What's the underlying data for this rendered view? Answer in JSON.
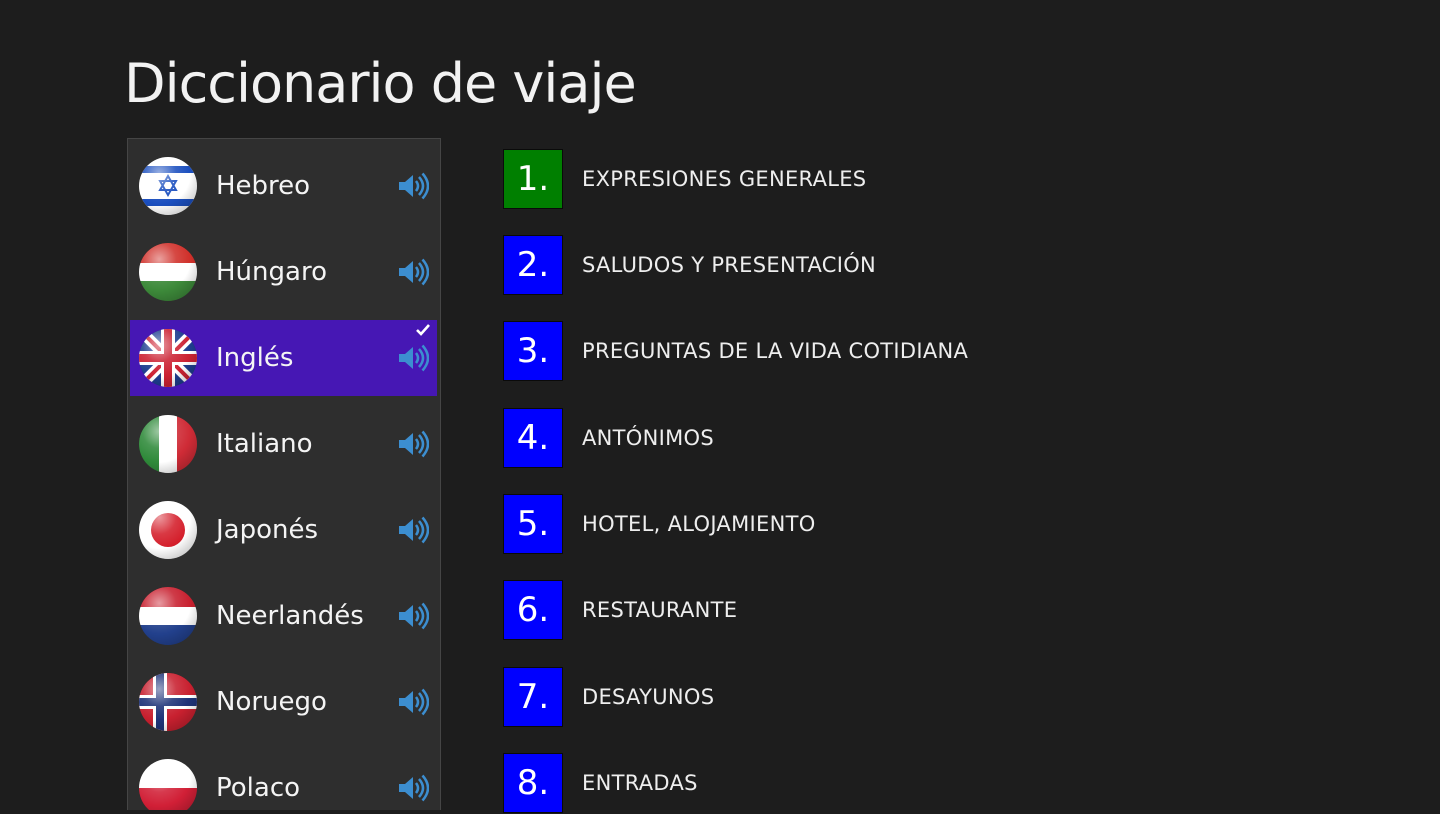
{
  "app": {
    "title": "Diccionario de viaje"
  },
  "colors": {
    "background": "#1d1d1d",
    "panel": "#2e2e2e",
    "selected": "#4617b4",
    "first_category": "#007f00",
    "category": "#0000ff",
    "speaker": "#3c8ed0"
  },
  "languages": [
    {
      "name": "Hebreo",
      "flag_icon": "israel-flag-icon",
      "selected": false
    },
    {
      "name": "Húngaro",
      "flag_icon": "hungary-flag-icon",
      "selected": false
    },
    {
      "name": "Inglés",
      "flag_icon": "uk-flag-icon",
      "selected": true
    },
    {
      "name": "Italiano",
      "flag_icon": "italy-flag-icon",
      "selected": false
    },
    {
      "name": "Japonés",
      "flag_icon": "japan-flag-icon",
      "selected": false
    },
    {
      "name": "Neerlandés",
      "flag_icon": "netherlands-flag-icon",
      "selected": false
    },
    {
      "name": "Noruego",
      "flag_icon": "norway-flag-icon",
      "selected": false
    },
    {
      "name": "Polaco",
      "flag_icon": "poland-flag-icon",
      "selected": false
    }
  ],
  "categories": [
    {
      "number": "1.",
      "label": "EXPRESIONES GENERALES",
      "color": "#007f00"
    },
    {
      "number": "2.",
      "label": "SALUDOS Y PRESENTACIÓN",
      "color": "#0000ff"
    },
    {
      "number": "3.",
      "label": "PREGUNTAS DE LA VIDA COTIDIANA",
      "color": "#0000ff"
    },
    {
      "number": "4.",
      "label": "ANTÓNIMOS",
      "color": "#0000ff"
    },
    {
      "number": "5.",
      "label": "HOTEL, ALOJAMIENTO",
      "color": "#0000ff"
    },
    {
      "number": "6.",
      "label": "RESTAURANTE",
      "color": "#0000ff"
    },
    {
      "number": "7.",
      "label": "DESAYUNOS",
      "color": "#0000ff"
    },
    {
      "number": "8.",
      "label": "ENTRADAS",
      "color": "#0000ff"
    }
  ]
}
